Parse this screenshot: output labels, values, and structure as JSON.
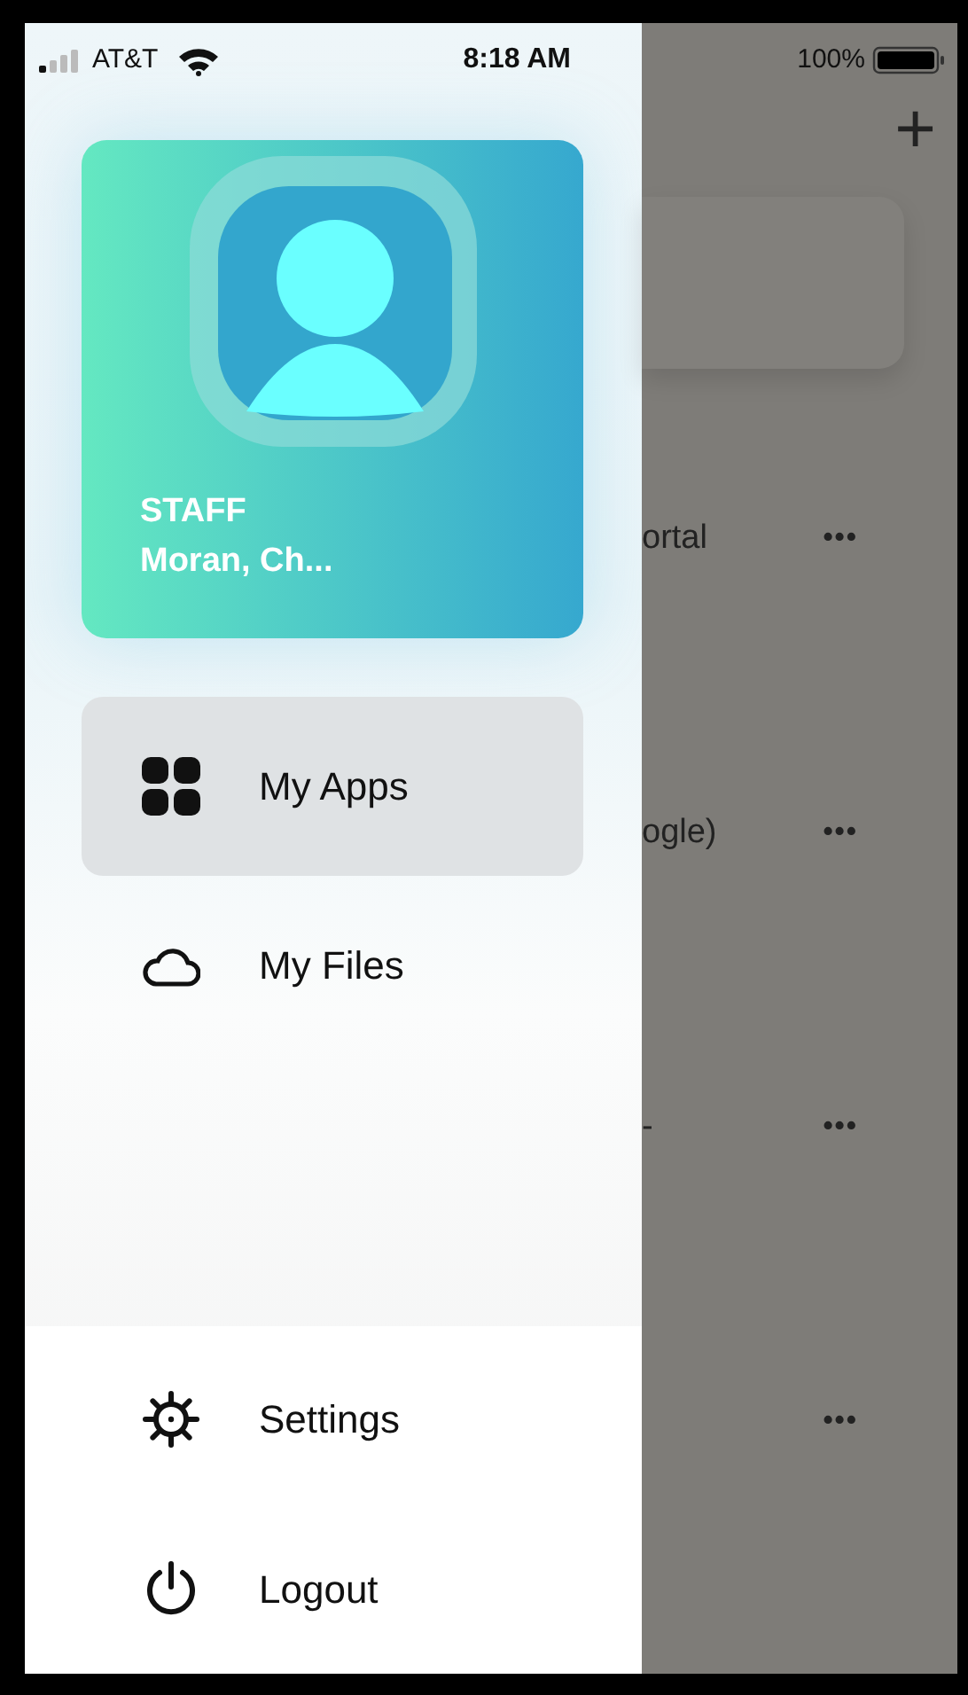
{
  "status_bar": {
    "carrier": "AT&T",
    "time": "8:18 AM",
    "battery": "100%"
  },
  "drawer": {
    "profile": {
      "role": "STAFF",
      "name": "Moran, Ch..."
    },
    "menu": [
      {
        "label": "My Apps",
        "selected": true
      },
      {
        "label": "My Files",
        "selected": false
      }
    ],
    "footer": [
      {
        "label": "Settings"
      },
      {
        "label": "Logout"
      }
    ]
  },
  "background": {
    "add_button": "+",
    "rows": [
      {
        "text": "ortal",
        "more": "•••"
      },
      {
        "text": "ogle)",
        "more": "•••"
      },
      {
        "text": "-",
        "more": "•••"
      },
      {
        "more": "•••"
      }
    ]
  }
}
